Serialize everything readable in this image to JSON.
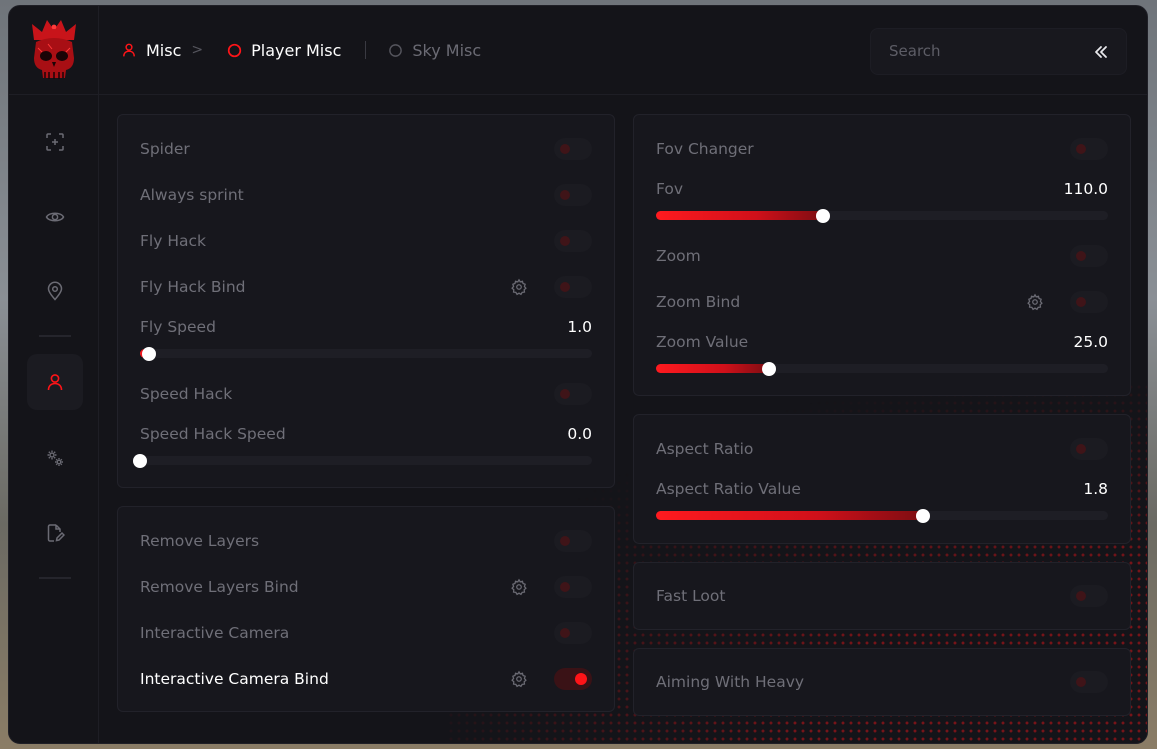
{
  "colors": {
    "accent": "#ff1418",
    "text_active": "#ffffff",
    "text_inactive": "#6f6f78",
    "panel_bg": "#17171d"
  },
  "sidebar": {
    "logo": "crowned-skull-logo",
    "items": [
      {
        "icon": "crosshair-icon",
        "active": false
      },
      {
        "icon": "eye-icon",
        "active": false
      },
      {
        "icon": "location-pin-icon",
        "active": false
      },
      {
        "icon": "user-icon",
        "active": true
      },
      {
        "icon": "gears-icon",
        "active": false
      },
      {
        "icon": "document-edit-icon",
        "active": false
      }
    ]
  },
  "breadcrumb": {
    "root": "Misc",
    "arrow": ">",
    "tabs": [
      {
        "label": "Player Misc",
        "active": true
      },
      {
        "label": "Sky Misc",
        "active": false
      }
    ]
  },
  "search": {
    "placeholder": "Search",
    "value": ""
  },
  "left_top_panel": {
    "spider": {
      "label": "Spider",
      "enabled": false
    },
    "always_sprint": {
      "label": "Always sprint",
      "enabled": false
    },
    "fly_hack": {
      "label": "Fly Hack",
      "enabled": false
    },
    "fly_hack_bind": {
      "label": "Fly Hack Bind",
      "enabled": false
    },
    "fly_speed": {
      "label": "Fly Speed",
      "value": "1.0",
      "fraction": 0.02
    },
    "speed_hack": {
      "label": "Speed Hack",
      "enabled": false
    },
    "speed_hack_speed": {
      "label": "Speed Hack Speed",
      "value": "0.0",
      "fraction": 0.0
    }
  },
  "left_bottom_panel": {
    "remove_layers": {
      "label": "Remove Layers",
      "enabled": false
    },
    "remove_layers_bind": {
      "label": "Remove Layers Bind",
      "enabled": false
    },
    "interactive_camera": {
      "label": "Interactive Camera",
      "enabled": false
    },
    "interactive_camera_bind": {
      "label": "Interactive Camera Bind",
      "enabled": true
    }
  },
  "right_top_panel": {
    "fov_changer": {
      "label": "Fov Changer",
      "enabled": false
    },
    "fov": {
      "label": "Fov",
      "value": "110.0",
      "fraction": 0.37
    },
    "zoom": {
      "label": "Zoom",
      "enabled": false
    },
    "zoom_bind": {
      "label": "Zoom Bind",
      "enabled": false
    },
    "zoom_value": {
      "label": "Zoom Value",
      "value": "25.0",
      "fraction": 0.25
    }
  },
  "right_aspect_panel": {
    "aspect_ratio": {
      "label": "Aspect Ratio",
      "enabled": false
    },
    "aspect_ratio_value": {
      "label": "Aspect Ratio Value",
      "value": "1.8",
      "fraction": 0.59
    }
  },
  "fast_loot": {
    "label": "Fast Loot",
    "enabled": false
  },
  "aiming_with_heavy": {
    "label": "Aiming With Heavy",
    "enabled": false
  }
}
